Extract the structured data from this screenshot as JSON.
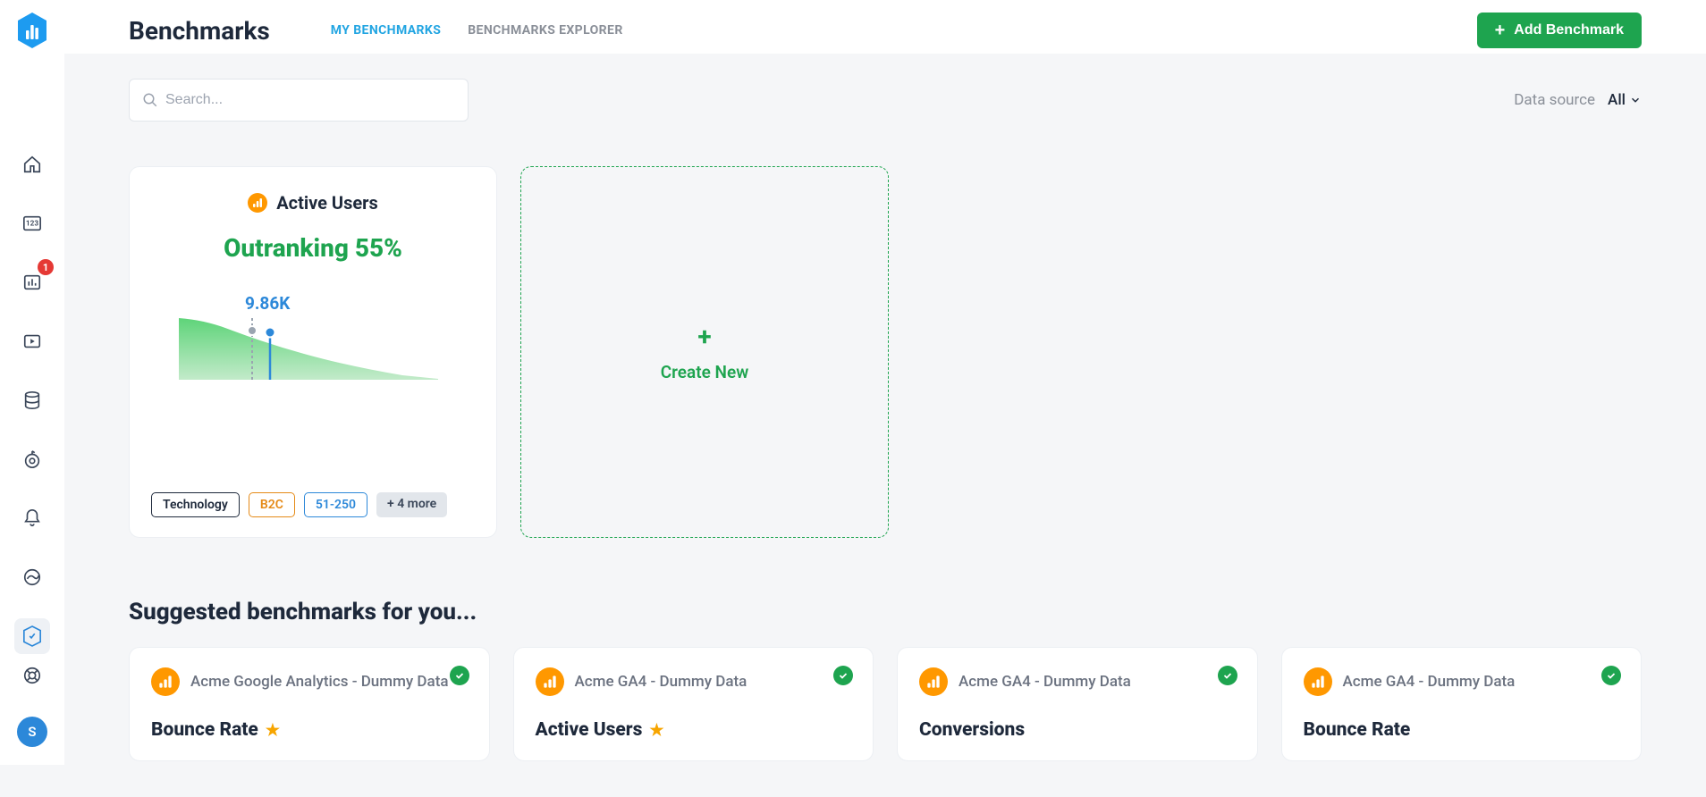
{
  "header": {
    "title": "Benchmarks",
    "tabs": {
      "my": "MY BENCHMARKS",
      "explorer": "BENCHMARKS EXPLORER"
    },
    "add_button": "Add Benchmark"
  },
  "search": {
    "placeholder": "Search..."
  },
  "data_source": {
    "label": "Data source",
    "value": "All"
  },
  "sidebar": {
    "badge_count": "1",
    "avatar_initial": "S"
  },
  "bench_card": {
    "title": "Active Users",
    "outranking": "Outranking 55%",
    "value": "9.86K",
    "tags": [
      "Technology",
      "B2C",
      "51-250",
      "+ 4 more"
    ]
  },
  "create_card": {
    "label": "Create New"
  },
  "suggested_title": "Suggested benchmarks for you...",
  "suggested": [
    {
      "source": "Acme Google Analytics - Dummy Data",
      "metric": "Bounce Rate",
      "starred": true
    },
    {
      "source": "Acme GA4 - Dummy Data",
      "metric": "Active Users",
      "starred": true
    },
    {
      "source": "Acme GA4 - Dummy Data",
      "metric": "Conversions",
      "starred": false
    },
    {
      "source": "Acme GA4 - Dummy Data",
      "metric": "Bounce Rate",
      "starred": false
    }
  ],
  "chart_data": {
    "type": "area",
    "title": "",
    "xlabel": "",
    "ylabel": "",
    "x": [
      0,
      1,
      2,
      3,
      4,
      5,
      6,
      7,
      8,
      9,
      10,
      11,
      12,
      13,
      14,
      15,
      16
    ],
    "values": [
      70,
      68,
      65,
      62,
      56,
      50,
      44,
      40,
      36,
      32,
      28,
      24,
      20,
      16,
      12,
      8,
      4
    ],
    "marker_index": 5,
    "marker_value": "9.86K",
    "ylim": [
      0,
      80
    ]
  }
}
